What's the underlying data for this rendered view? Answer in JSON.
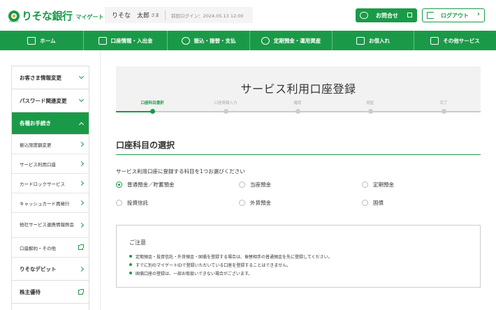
{
  "header": {
    "logo_text": "りそな銀行",
    "logo_sub": "マイゲート",
    "logo_tiny": "resona",
    "user_name": "りそな　太郎",
    "honorific": "さま",
    "last_login": "前回ログイン：2024.05.13 12:00",
    "contact_label": "お問合せ",
    "logout_label": "ログアウト"
  },
  "nav": {
    "items": [
      {
        "label": "ホーム",
        "icon": "home-icon"
      },
      {
        "label": "口座情報・入出金",
        "icon": "bank-icon"
      },
      {
        "label": "振込・振替・支払",
        "icon": "transfer-icon"
      },
      {
        "label": "定期預金・運用資産",
        "icon": "piggy-bank-icon"
      },
      {
        "label": "お借入れ",
        "icon": "loan-icon"
      },
      {
        "label": "その他サービス",
        "icon": "grid-icon"
      }
    ]
  },
  "sidebar": {
    "items": [
      {
        "label": "お客さま情報変更"
      },
      {
        "label": "パスワード関連変更"
      },
      {
        "label": "各種お手続き"
      }
    ],
    "subitems": [
      {
        "label": "振込限度額変更"
      },
      {
        "label": "サービス利用口座"
      },
      {
        "label": "カードロックサービス"
      },
      {
        "label": "キャッシュカード再発行"
      },
      {
        "label": "他社サービス連携情報照会"
      },
      {
        "label": "口座解約・その他"
      }
    ],
    "bottom_items": [
      {
        "label": "りそなデビット"
      },
      {
        "label": "株主優待"
      }
    ]
  },
  "main": {
    "page_title": "サービス利用口座登録",
    "steps": [
      {
        "label": "口座科目選択"
      },
      {
        "label": "口座情報入力"
      },
      {
        "label": "確認"
      },
      {
        "label": "認証"
      },
      {
        "label": "完了"
      }
    ],
    "current_step": 1,
    "section_title": "口座科目の選択",
    "instruction": "サービス利用口座に登録する科目を1つお選びください",
    "options": [
      {
        "label": "普通預金／貯蓄預金",
        "selected": true
      },
      {
        "label": "当座預金",
        "selected": false
      },
      {
        "label": "定期預金",
        "selected": false
      },
      {
        "label": "投資信託",
        "selected": false
      },
      {
        "label": "外貨預金",
        "selected": false
      },
      {
        "label": "国債",
        "selected": false
      }
    ],
    "notice": {
      "title": "ご注意",
      "items": [
        "定期預金・投資信託・外貨預金・国債を登録する場合は、振替相手の普通預金を先に登録してください。",
        "すでに別のマイゲートIDで登録いただいている口座を登録することはできません。",
        "国債口座の登録は、一部お取扱いできない場合がございます。"
      ]
    }
  },
  "colors": {
    "accent": "#1a9a48",
    "panel": "#f2f2f2"
  }
}
